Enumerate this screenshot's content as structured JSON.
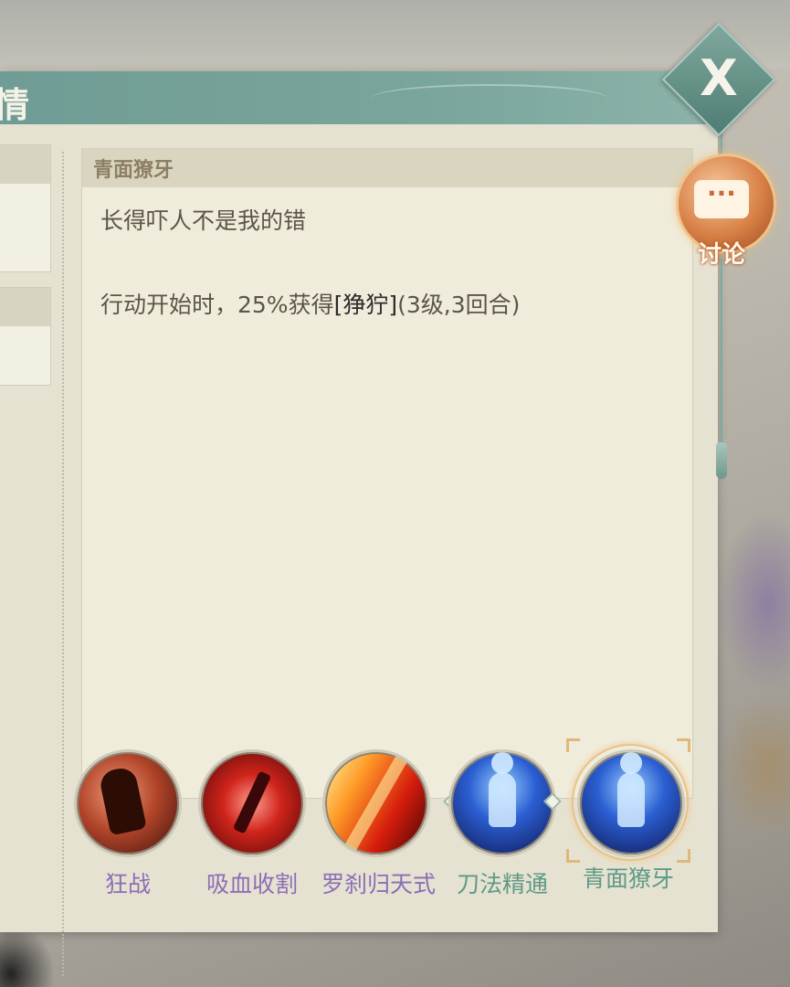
{
  "window": {
    "title_fragment": "情"
  },
  "description": {
    "header": "青面獠牙",
    "title_line": "长得吓人不是我的错",
    "effect_prefix": "行动开始时，25%获得",
    "effect_keyword": "[狰狞]",
    "effect_suffix": "(3级,3回合)"
  },
  "skills": [
    {
      "label": "狂战",
      "icon": "berserker-icon",
      "color": "#8c6db4"
    },
    {
      "label": "吸血收割",
      "icon": "blood-sword-icon",
      "color": "#8c6db4"
    },
    {
      "label": "罗刹归天式",
      "icon": "flame-slash-icon",
      "color": "#8c6db4"
    },
    {
      "label": "刀法精通",
      "icon": "blade-mastery-icon",
      "color": "#5f9a86"
    },
    {
      "label": "青面獠牙",
      "icon": "fierce-face-icon",
      "color": "#5f9a86",
      "selected": true
    }
  ],
  "close": {
    "label": "X"
  },
  "discussion": {
    "label": "讨论",
    "bubble": "···"
  }
}
